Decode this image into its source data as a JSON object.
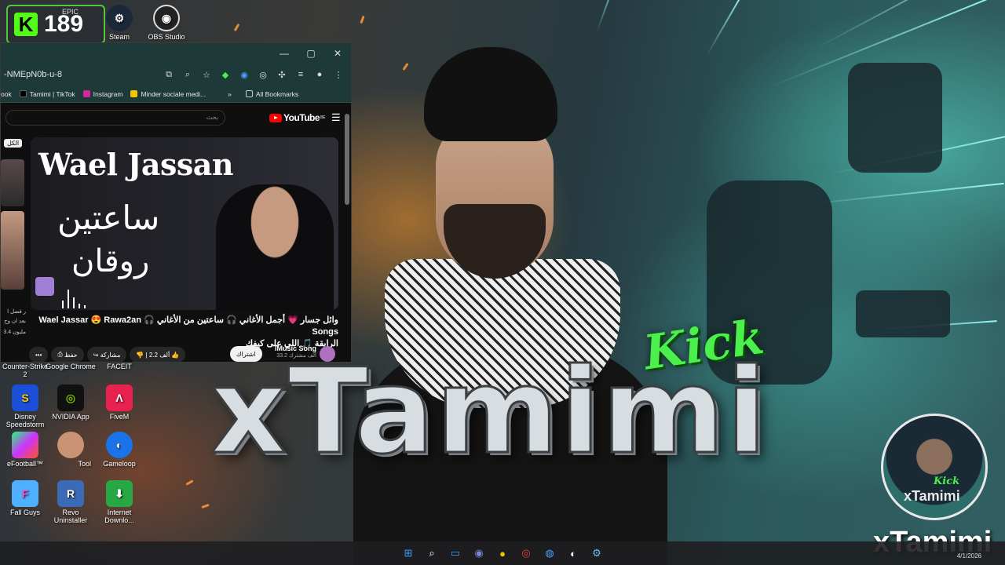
{
  "badge": {
    "count": "189",
    "epic_label": "EPIC",
    "k_letter": "K"
  },
  "top_icons": [
    {
      "label": "Steam"
    },
    {
      "label": "OBS Studio"
    }
  ],
  "desktop_icons": [
    {
      "label": "Counter-Strike 2"
    },
    {
      "label": "Google Chrome"
    },
    {
      "label": "FACEIT"
    },
    {
      "label": "Disney Speedstorm"
    },
    {
      "label": "NVIDIA App"
    },
    {
      "label": "FiveM"
    },
    {
      "label": "eFootball™"
    },
    {
      "label": "Tool"
    },
    {
      "label": "Gameloop"
    },
    {
      "label": "Fall Guys"
    },
    {
      "label": "Revo Uninstaller"
    },
    {
      "label": "Internet Downlo..."
    }
  ],
  "browser": {
    "url": "-NMEpN0b-u-8",
    "bookmarks": [
      {
        "label": "ook"
      },
      {
        "label": "Tamimi | TikTok",
        "color": "#000000"
      },
      {
        "label": "Instagram",
        "color": "#d6249f"
      },
      {
        "label": "Minder sociale medi...",
        "color": "#f5c400"
      }
    ],
    "more": "»",
    "all_bookmarks": "All Bookmarks"
  },
  "youtube": {
    "search_placeholder": "بحث",
    "logo": "YouTube",
    "country": "BE",
    "side_label": "الكل",
    "side_text1": "ر فضل ا",
    "side_text2": "بعد ان وح",
    "side_text3": "3.4 مليون",
    "thumb_title": "Wael Jassan",
    "thumb_arabic1": "ساعتين",
    "thumb_arabic2": "روقان",
    "video_title_line1": "وائل جسار 💗 أجمل الأغاني 🎧 ساعتين من الأغاني 🎧 Wael Jassar 😍 Rawa2an Songs",
    "video_title_line2": "الرايقة 🎵 اللي على كيفك",
    "more_btn": "•••",
    "save_btn": "حفظ",
    "share_btn": "مشاركة",
    "likes": "2.2 ألف",
    "subscribe": "اشتراك",
    "channel_name": "IMusic Song",
    "channel_subs": "33.2 ألف مشترك"
  },
  "wallpaper": {
    "kick": "Kick",
    "brand": "xTamimi",
    "avatar_kick": "Kick",
    "avatar_brand": "xTamimi",
    "watermark": "xTamimi"
  },
  "taskbar": {
    "date": "4/1/2026"
  },
  "colors": {
    "kick_green": "#53fc18",
    "youtube_red": "#ff0000",
    "chrome_frame": "#1e3a38"
  }
}
